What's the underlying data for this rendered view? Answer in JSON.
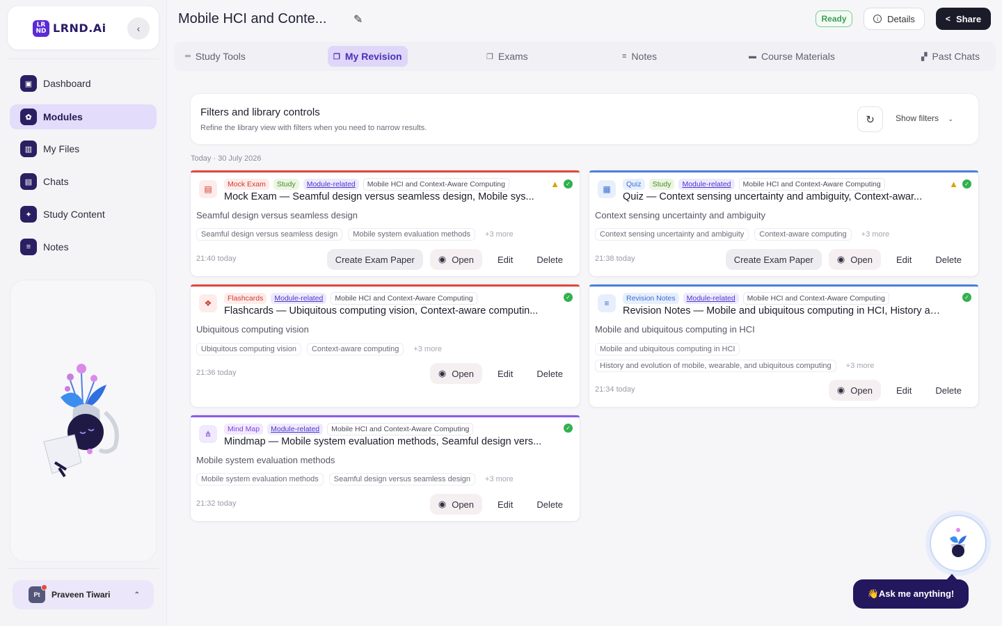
{
  "sidebar": {
    "logo_mark": "LR ND",
    "logo_text": "LRND.Ai",
    "collapse_icon": "‹",
    "items": [
      {
        "label": "Dashboard",
        "icon": "dashboard-icon",
        "glyph": "▣"
      },
      {
        "label": "Modules",
        "icon": "modules-icon",
        "glyph": "✿"
      },
      {
        "label": "My Files",
        "icon": "files-icon",
        "glyph": "▥"
      },
      {
        "label": "Chats",
        "icon": "chats-icon",
        "glyph": "▤"
      },
      {
        "label": "Study Content",
        "icon": "study-content-icon",
        "glyph": "✦"
      },
      {
        "label": "Notes",
        "icon": "notes-icon",
        "glyph": "≡"
      }
    ],
    "user": {
      "initials": "Pt",
      "name": "Praveen Tiwari",
      "chevron": "⌃"
    }
  },
  "header": {
    "title": "Mobile HCI and Conte...",
    "edit_icon": "✎",
    "ready_label": "Ready",
    "details_label": "Details",
    "share_label": "Share"
  },
  "tabs": [
    {
      "label": "Study Tools",
      "glyph": "═"
    },
    {
      "label": "My Revision",
      "glyph": "❐"
    },
    {
      "label": "Exams",
      "glyph": "❐"
    },
    {
      "label": "Notes",
      "glyph": "≡"
    },
    {
      "label": "Course Materials",
      "glyph": "▬"
    },
    {
      "label": "Past Chats",
      "glyph": "▞"
    }
  ],
  "filters": {
    "title": "Filters and library controls",
    "subtitle": "Refine the library view with filters when you need to narrow results.",
    "refresh_icon": "↻",
    "show_label": "Show filters",
    "chevron": "⌄"
  },
  "date_label": "Today · 30 July 2026",
  "cards": [
    {
      "type_tag": "Mock Exam",
      "study_tag": "Study",
      "module_tag": "Module-related",
      "course_tag": "Mobile HCI and Context-Aware Computing",
      "title": "Mock Exam — Seamful design versus seamless design, Mobile sys...",
      "subtitle": "Seamful design versus seamless design",
      "chips": [
        "Seamful design versus seamless design",
        "Mobile system evaluation methods"
      ],
      "more": "+3 more",
      "time": "21:40 today",
      "create_label": "Create Exam Paper",
      "open_label": "Open",
      "edit_label": "Edit",
      "delete_label": "Delete",
      "accent": "#e2473b",
      "tag_bg": "#fdecea",
      "tag_color": "#d0392c",
      "icon_glyph": "▤"
    },
    {
      "type_tag": "Quiz",
      "study_tag": "Study",
      "module_tag": "Module-related",
      "course_tag": "Mobile HCI and Context-Aware Computing",
      "title": "Quiz — Context sensing uncertainty and ambiguity, Context-awar...",
      "subtitle": "Context sensing uncertainty and ambiguity",
      "chips": [
        "Context sensing uncertainty and ambiguity",
        "Context-aware computing"
      ],
      "more": "+3 more",
      "time": "21:38 today",
      "create_label": "Create Exam Paper",
      "open_label": "Open",
      "edit_label": "Edit",
      "delete_label": "Delete",
      "accent": "#4a7fe0",
      "tag_bg": "#e7effd",
      "tag_color": "#3a6cd0",
      "icon_glyph": "▦"
    },
    {
      "type_tag": "Flashcards",
      "module_tag": "Module-related",
      "course_tag": "Mobile HCI and Context-Aware Computing",
      "title": "Flashcards — Ubiquitous computing vision, Context-aware computin...",
      "subtitle": "Ubiquitous computing vision",
      "chips": [
        "Ubiquitous computing vision",
        "Context-aware computing"
      ],
      "more": "+3 more",
      "time": "21:36 today",
      "open_label": "Open",
      "edit_label": "Edit",
      "delete_label": "Delete",
      "accent": "#e2473b",
      "tag_bg": "#fdecea",
      "tag_color": "#d0392c",
      "icon_glyph": "❖"
    },
    {
      "type_tag": "Revision Notes",
      "module_tag": "Module-related",
      "course_tag": "Mobile HCI and Context-Aware Computing",
      "title": "Revision Notes — Mobile and ubiquitous computing in HCI, History an...",
      "subtitle": "Mobile and ubiquitous computing in HCI",
      "chips": [
        "Mobile and ubiquitous computing in HCI"
      ],
      "chips2": [
        "History and evolution of mobile, wearable, and ubiquitous computing"
      ],
      "more": "+3 more",
      "time": "21:34 today",
      "open_label": "Open",
      "edit_label": "Edit",
      "delete_label": "Delete",
      "accent": "#4a7fe0",
      "tag_bg": "#e7effd",
      "tag_color": "#3a6cd0",
      "icon_glyph": "≡"
    },
    {
      "type_tag": "Mind Map",
      "module_tag": "Module-related",
      "course_tag": "Mobile HCI and Context-Aware Computing",
      "title": "Mindmap — Mobile system evaluation methods, Seamful design vers...",
      "subtitle": "Mobile system evaluation methods",
      "chips": [
        "Mobile system evaluation methods",
        "Seamful design versus seamless design"
      ],
      "more": "+3 more",
      "time": "21:32 today",
      "open_label": "Open",
      "edit_label": "Edit",
      "delete_label": "Delete",
      "accent": "#8d5ae8",
      "tag_bg": "#f1e9fd",
      "tag_color": "#7c45dc",
      "icon_glyph": "⋔"
    }
  ],
  "assistant": {
    "ask_label": "👋Ask me anything!"
  }
}
